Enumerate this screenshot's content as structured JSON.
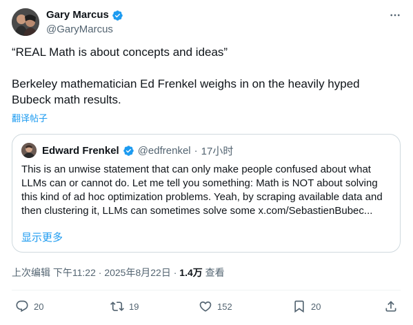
{
  "tweet": {
    "author_name": "Gary Marcus",
    "author_handle": "@GaryMarcus",
    "paragraph1": "“REAL Math is about concepts and ideas”",
    "paragraph2": "Berkeley mathematician Ed Frenkel weighs in on the heavily hyped Bubeck math results.",
    "translate_label": "翻译帖子"
  },
  "quote": {
    "author_name": "Edward Frenkel",
    "author_handle": "@edfrenkel",
    "separator": "·",
    "time": "17小时",
    "text": "This is an unwise statement that can only make people confused about what LLMs can or cannot do. Let me tell you something: Math is NOT about solving this kind of ad hoc optimization problems. Yeah, by scraping available data and then clustering it, LLMs can sometimes solve some x.com/SebastienBubec...",
    "show_more": "显示更多"
  },
  "meta": {
    "edited_time": "上次编辑 下午11:22 · 2025年8月22日 · ",
    "views_count": "1.4万",
    "views_label": " 查看"
  },
  "actions": {
    "replies": "20",
    "reposts": "19",
    "likes": "152",
    "bookmarks": "20"
  },
  "icons": {
    "verified": "verified-badge-icon",
    "more": "more-icon",
    "reply": "reply-icon",
    "repost": "repost-icon",
    "like": "heart-icon",
    "bookmark": "bookmark-icon",
    "share": "share-icon"
  },
  "colors": {
    "accent": "#1d9bf0",
    "text": "#0f1419",
    "secondary": "#536471",
    "border": "#cfd9de"
  }
}
